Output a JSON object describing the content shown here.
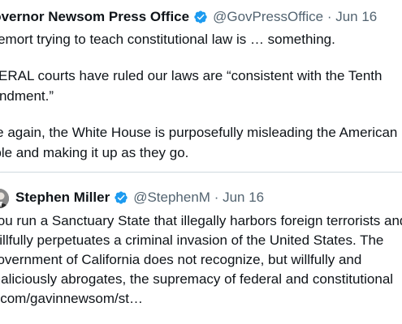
{
  "tweet": {
    "display_name": "Governor Newsom Press Office",
    "handle": "@GovPressOffice",
    "separator": "·",
    "date": "Jun 16",
    "paragraphs": [
      [
        "Voldemort trying to teach constitutional law is … something."
      ],
      [
        "FEDERAL courts have ruled our laws are “consistent with the Tenth",
        "Amendment.”"
      ],
      [
        "Once again, the White House is purposefully misleading the American",
        "people and making it up as they go."
      ]
    ]
  },
  "quote": {
    "display_name": "Stephen Miller",
    "handle": "@StephenM",
    "separator": "·",
    "date": "Jun 16",
    "lines": [
      "You run a Sanctuary State that illegally harbors foreign terrorists and",
      "willfully perpetuates a criminal invasion of the United States. The",
      "government of California does not recognize, but willfully and",
      "maliciously abrogates, the supremacy of federal and constitutional",
      "x.com/gavinnewsom/st…"
    ]
  },
  "colors": {
    "text": "#0f1419",
    "secondary": "#536471",
    "verified": "#1d9bf0",
    "border": "#cfd9de"
  },
  "icons": {
    "verified": "verified-badge-icon"
  }
}
